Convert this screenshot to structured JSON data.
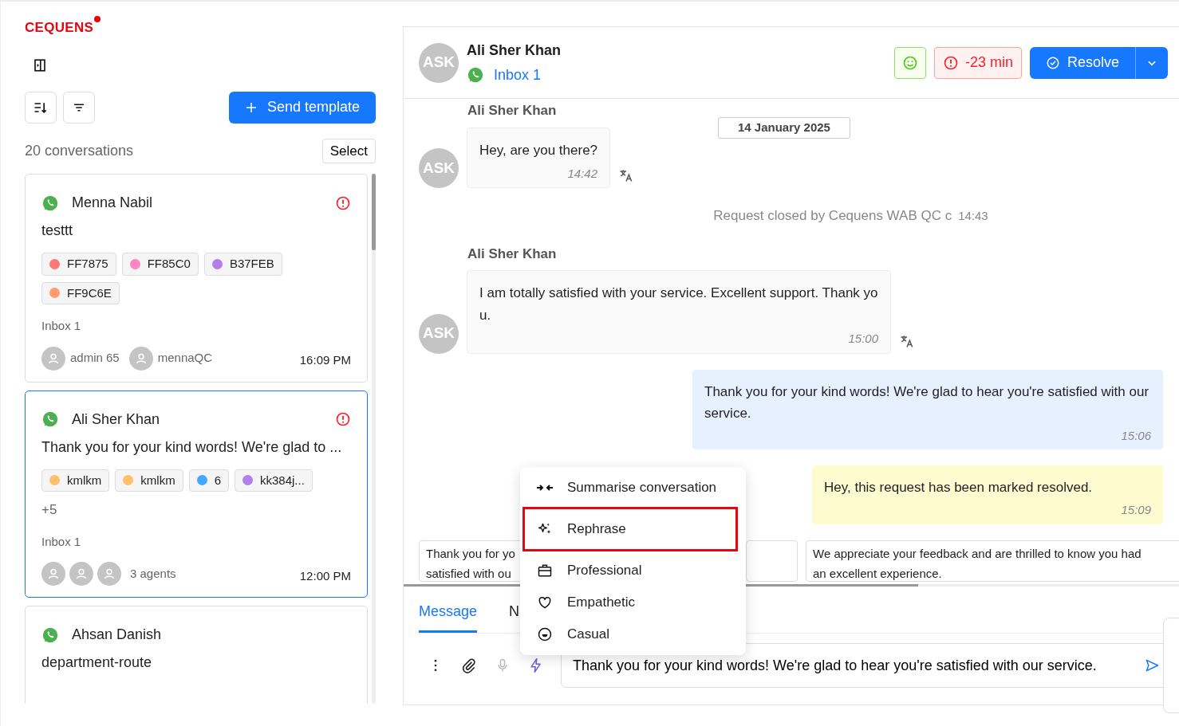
{
  "brand": {
    "name": "CEQUENS"
  },
  "list_toolbar": {
    "send_template": "Send template",
    "count": "20 conversations",
    "select": "Select"
  },
  "conversations": [
    {
      "name": "Menna Nabil",
      "alert": true,
      "selected": false,
      "preview": "testtt",
      "tags": [
        {
          "label": "FF7875",
          "color": "#ff7875"
        },
        {
          "label": "FF85C0",
          "color": "#ff85c0"
        },
        {
          "label": "B37FEB",
          "color": "#b37feb"
        },
        {
          "label": "FF9C6E",
          "color": "#ff9c6e"
        }
      ],
      "inbox": "Inbox 1",
      "agents": [
        {
          "kind": "named",
          "name": "admin 65"
        },
        {
          "kind": "named",
          "name": "mennaQC"
        }
      ],
      "time": "16:09 PM"
    },
    {
      "name": "Ali Sher Khan",
      "alert": true,
      "selected": true,
      "preview": "Thank you for your kind words! We're glad to ...",
      "tags": [
        {
          "label": "kmlkm",
          "color": "#ffc069"
        },
        {
          "label": "kmlkm",
          "color": "#ffc069"
        },
        {
          "label": "6",
          "color": "#40a9ff"
        },
        {
          "label": "kk384j...",
          "color": "#b37feb"
        }
      ],
      "more_tags": "+5",
      "inbox": "Inbox 1",
      "agents": [
        {
          "kind": "avatar"
        },
        {
          "kind": "avatar"
        },
        {
          "kind": "avatar"
        }
      ],
      "agents_label": "3 agents",
      "time": "12:00 PM"
    },
    {
      "name": "Ahsan Danish",
      "alert": false,
      "selected": false,
      "preview": "department-route"
    }
  ],
  "chat_header": {
    "initials": "ASK",
    "name": "Ali Sher Khan",
    "inbox": "Inbox 1",
    "sla": "-23 min",
    "resolve": "Resolve"
  },
  "date_divider": "14 January 2025",
  "messages": [
    {
      "kind": "sender",
      "text": "Ali Sher Khan"
    },
    {
      "kind": "incoming",
      "initials": "ASK",
      "text": "Hey, are you there?",
      "time": "14:42"
    },
    {
      "kind": "system",
      "text": "Request closed by Cequens WAB QC c",
      "time": "14:43"
    },
    {
      "kind": "sender",
      "text": "Ali Sher Khan"
    },
    {
      "kind": "incoming",
      "initials": "ASK",
      "text": "I am totally satisfied with your service. Excellent support. Thank you.",
      "time": "15:00"
    },
    {
      "kind": "outgoing",
      "text": "Thank you for your kind words! We're glad to hear you're satisfied with our service.",
      "time": "15:06"
    },
    {
      "kind": "resolved",
      "text": "Hey, this request has been marked resolved.",
      "time": "15:09"
    }
  ],
  "suggestions": [
    {
      "kind": "text",
      "lines": [
        "Thank you for yo",
        "satisfied with ou"
      ]
    },
    {
      "kind": "covered"
    },
    {
      "kind": "text",
      "lines": [
        "We appreciate your feedback and are thrilled to know you had",
        "an excellent experience."
      ]
    }
  ],
  "composer": {
    "tabs": [
      {
        "label": "Message",
        "selected": true
      },
      {
        "label": "N",
        "selected": false
      }
    ],
    "tools": [
      {
        "kind": "more",
        "disabled": false,
        "active": false
      },
      {
        "kind": "attach",
        "disabled": false,
        "active": false
      },
      {
        "kind": "mic",
        "disabled": true,
        "active": false
      },
      {
        "kind": "ai",
        "disabled": false,
        "active": true
      }
    ],
    "value": "Thank you for your kind words! We're glad to hear you're satisfied with our service."
  },
  "ai_menu": [
    {
      "kind": "summarise",
      "label": "Summarise conversation",
      "selected": false
    },
    {
      "kind": "rephrase",
      "label": "Rephrase",
      "selected": true
    },
    {
      "kind": "professional",
      "label": "Professional",
      "selected": false
    },
    {
      "kind": "empathetic",
      "label": "Empathetic",
      "selected": false
    },
    {
      "kind": "casual",
      "label": "Casual",
      "selected": false
    }
  ]
}
